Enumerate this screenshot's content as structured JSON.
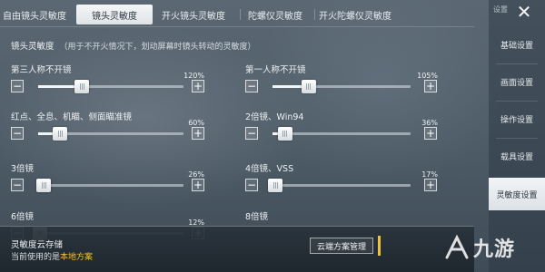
{
  "tabs": [
    {
      "label": "自由镜头灵敏度",
      "active": false
    },
    {
      "label": "镜头灵敏度",
      "active": true
    },
    {
      "label": "开火镜头灵敏度",
      "active": false
    },
    {
      "label": "陀螺仪灵敏度",
      "active": false
    },
    {
      "label": "开火陀螺仪灵敏度",
      "active": false
    }
  ],
  "sidebar": {
    "top_label": "设置",
    "items": [
      {
        "label": "基础设置",
        "active": false
      },
      {
        "label": "画面设置",
        "active": false
      },
      {
        "label": "操作设置",
        "active": false
      },
      {
        "label": "载具设置",
        "active": false
      },
      {
        "label": "灵敏度设置",
        "active": true
      }
    ]
  },
  "section": {
    "title": "镜头灵敏度",
    "hint": "（用于不开火情况下，划动屏幕时镜头转动的灵敏度）"
  },
  "settings": [
    {
      "label": "第三人称不开镜",
      "value_text": "120%",
      "value": 120,
      "fraction": 0.3
    },
    {
      "label": "第一人称不开镜",
      "value_text": "105%",
      "value": 105,
      "fraction": 0.26
    },
    {
      "label": "红点、全息、机瞄、侧面瞄准镜",
      "value_text": "60%",
      "value": 60,
      "fraction": 0.15
    },
    {
      "label": "2倍镜、Win94",
      "value_text": "36%",
      "value": 36,
      "fraction": 0.09
    },
    {
      "label": "3倍镜",
      "value_text": "26%",
      "value": 26,
      "fraction": 0.04
    },
    {
      "label": "4倍镜、VSS",
      "value_text": "17%",
      "value": 17,
      "fraction": 0.02
    },
    {
      "label": "6倍镜",
      "value_text": "12%",
      "value": 12,
      "fraction": 0.01
    },
    {
      "label": "8倍镜",
      "value_text": "",
      "value": null,
      "fraction": null
    }
  ],
  "cloud": {
    "title": "灵敏度云存储",
    "status_prefix": "当前使用的是",
    "plan_name": "本地方案",
    "button_label": "云端方案管理"
  },
  "watermark": {
    "text": "九游"
  },
  "colors": {
    "accent": "#f0c23a",
    "active_tab": "#eef1f3"
  }
}
